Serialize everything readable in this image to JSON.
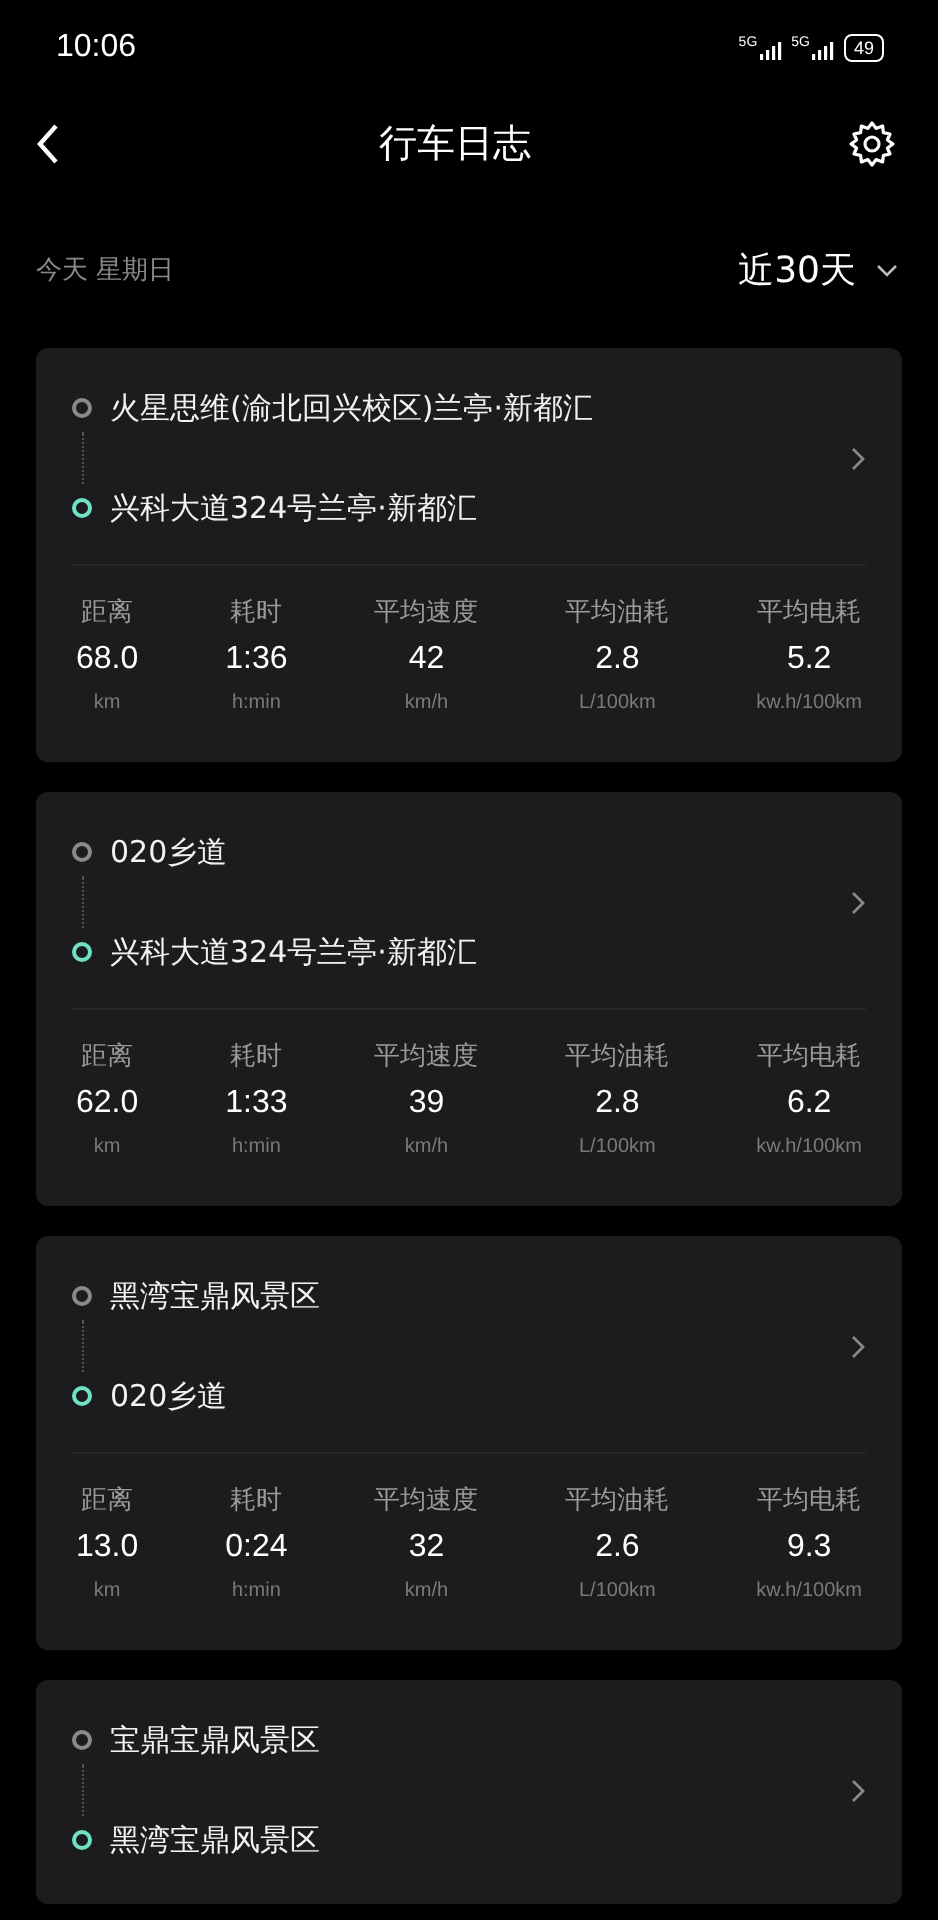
{
  "status_bar": {
    "time": "10:06",
    "networks": [
      "5G",
      "5G"
    ],
    "battery": "49"
  },
  "header": {
    "title": "行车日志"
  },
  "filter": {
    "date": "今天 星期日",
    "range": "近30天"
  },
  "trips": [
    {
      "start": "火星思维(渝北回兴校区)兰亭·新都汇",
      "end": "兴科大道324号兰亭·新都汇",
      "stats": [
        {
          "label": "距离",
          "value": "68.0",
          "unit": "km"
        },
        {
          "label": "耗时",
          "value": "1:36",
          "unit": "h:min"
        },
        {
          "label": "平均速度",
          "value": "42",
          "unit": "km/h"
        },
        {
          "label": "平均油耗",
          "value": "2.8",
          "unit": "L/100km"
        },
        {
          "label": "平均电耗",
          "value": "5.2",
          "unit": "kw.h/100km"
        }
      ]
    },
    {
      "start": "020乡道",
      "end": "兴科大道324号兰亭·新都汇",
      "stats": [
        {
          "label": "距离",
          "value": "62.0",
          "unit": "km"
        },
        {
          "label": "耗时",
          "value": "1:33",
          "unit": "h:min"
        },
        {
          "label": "平均速度",
          "value": "39",
          "unit": "km/h"
        },
        {
          "label": "平均油耗",
          "value": "2.8",
          "unit": "L/100km"
        },
        {
          "label": "平均电耗",
          "value": "6.2",
          "unit": "kw.h/100km"
        }
      ]
    },
    {
      "start": "黑湾宝鼎风景区",
      "end": "020乡道",
      "stats": [
        {
          "label": "距离",
          "value": "13.0",
          "unit": "km"
        },
        {
          "label": "耗时",
          "value": "0:24",
          "unit": "h:min"
        },
        {
          "label": "平均速度",
          "value": "32",
          "unit": "km/h"
        },
        {
          "label": "平均油耗",
          "value": "2.6",
          "unit": "L/100km"
        },
        {
          "label": "平均电耗",
          "value": "9.3",
          "unit": "kw.h/100km"
        }
      ]
    },
    {
      "start": "宝鼎宝鼎风景区",
      "end": "黑湾宝鼎风景区"
    }
  ]
}
